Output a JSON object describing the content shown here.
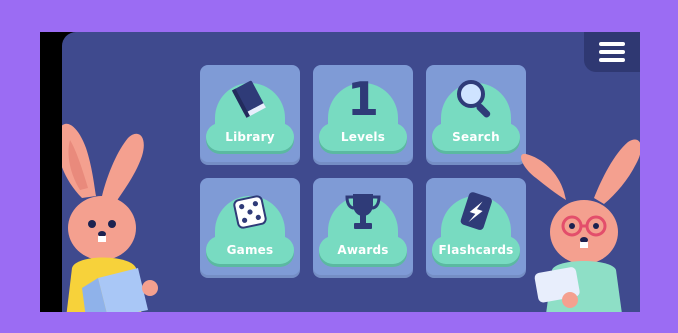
{
  "tiles": [
    {
      "label": "Library",
      "icon": "book-icon"
    },
    {
      "label": "Levels",
      "icon": "number-one-icon"
    },
    {
      "label": "Search",
      "icon": "magnifier-icon"
    },
    {
      "label": "Games",
      "icon": "dice-icon"
    },
    {
      "label": "Awards",
      "icon": "trophy-icon"
    },
    {
      "label": "Flashcards",
      "icon": "flashcard-icon"
    }
  ],
  "levels_icon_text": "1",
  "menu": {
    "icon": "hamburger-menu-icon"
  },
  "colors": {
    "background": "#9b6cf3",
    "screen": "#3f4a8e",
    "tile": "#7f9bd6",
    "accent": "#78dbc1",
    "bunny": "#f4a08f"
  }
}
